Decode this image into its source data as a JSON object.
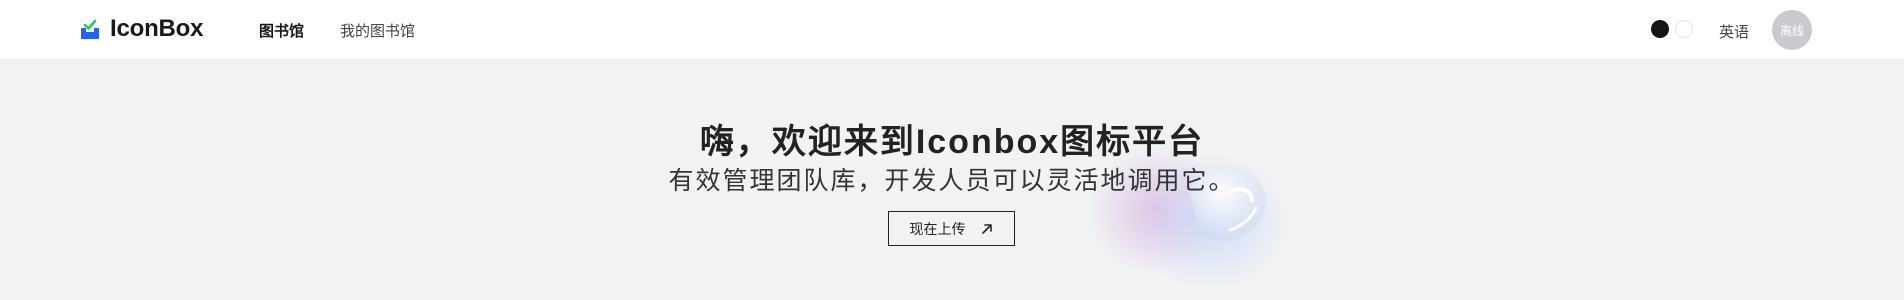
{
  "header": {
    "brand": "IconBox",
    "nav": [
      {
        "label": "图书馆",
        "active": true
      },
      {
        "label": "我的图书馆",
        "active": false
      }
    ],
    "theme_options": [
      "dark",
      "light"
    ],
    "language_label": "英语",
    "avatar_label": "离线"
  },
  "hero": {
    "title": "嗨，欢迎来到Iconbox图标平台",
    "subtitle": "有效管理团队库，开发人员可以灵活地调用它。",
    "upload_button": "现在上传"
  },
  "colors": {
    "page_background": "#f1f2f4",
    "header_background": "#ffffff",
    "logo_blue": "#2563eb",
    "logo_green": "#22c55e",
    "avatar_gray": "#c9cace"
  },
  "icons": {
    "logo": "iconbox-logo-icon",
    "upload_arrow": "arrow-up-right-icon"
  }
}
